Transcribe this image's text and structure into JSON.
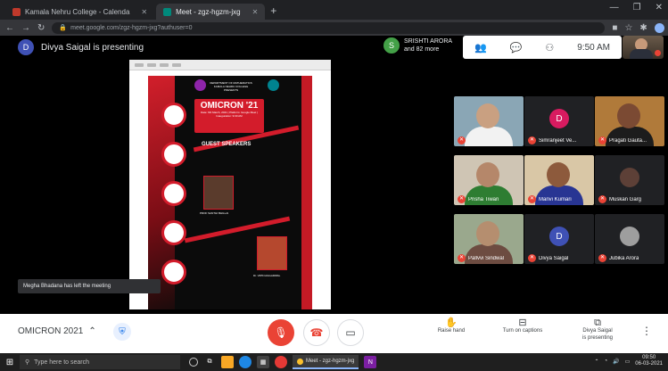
{
  "browser": {
    "tabs": [
      {
        "label": "Kamala Nehru College - Calenda",
        "favicon_color": "#c0392b",
        "active": false
      },
      {
        "label": "Meet - zgz-hgzm-jxg",
        "favicon_color": "#00897b",
        "active": true
      }
    ],
    "url": "meet.google.com/zgz-hgzm-jxg?authuser=0"
  },
  "meet": {
    "presenter_initial": "D",
    "presenter_text": "Divya Saigal is presenting",
    "pinned_initial": "S",
    "pinned_name": "SRISHTI ARORA",
    "pinned_more": "and 82 more",
    "clock": "9:50 AM",
    "toast": "Megha Bhadana has left the meeting",
    "meeting_title": "OMICRON 2021"
  },
  "poster": {
    "dept_line1": "DEPARTMENT OF MATHEMATICS",
    "dept_line2": "KAMALA NEHRU COLLEGE",
    "dept_line3": "PRESENTS",
    "event": "OMICRON '21",
    "event_details": "Date: 6th March, 2021 | Platform: Google Meet | Inauguration: 9:30 AM",
    "guest_heading": "GUEST SPEAKERS",
    "guest1": "PROF SANTHI BHILLAI",
    "guest2": "Dr. VIPIN AGGARWAL"
  },
  "participants": [
    {
      "name": "",
      "initial": "",
      "video": true,
      "skin": "#c9a081",
      "cloth": "#f2f2f2",
      "bg": "#8aa6b5"
    },
    {
      "name": "Simranjeet Ve...",
      "initial": "D",
      "video": false,
      "avatar_color": "#d81b60"
    },
    {
      "name": "Pragati Gauta...",
      "initial": "",
      "video": true,
      "skin": "#7b4a33",
      "cloth": "#1c1c1c",
      "bg": "#b07a3a"
    },
    {
      "name": "Prisha Tiwari",
      "initial": "",
      "video": true,
      "skin": "#b5876a",
      "cloth": "#2e7d32",
      "bg": "#cfc5b4"
    },
    {
      "name": "Manvi Kumari",
      "initial": "",
      "video": true,
      "skin": "#8d5a3c",
      "cloth": "#283593",
      "bg": "#d9c7a6"
    },
    {
      "name": "Muskan Garg",
      "initial": "",
      "video": false,
      "avatar_color": "#5d4037"
    },
    {
      "name": "Pallvvi Sindwal",
      "initial": "",
      "video": true,
      "skin": "#b58e6f",
      "cloth": "#6d4c41",
      "bg": "#9aa88d"
    },
    {
      "name": "Divya Saigal",
      "initial": "D",
      "video": false,
      "avatar_color": "#3f51b5"
    },
    {
      "name": "Jubika Arora",
      "initial": "",
      "video": false,
      "avatar_color": "#9e9e9e"
    }
  ],
  "controls": {
    "raise_hand": "Raise hand",
    "captions": "Turn on captions",
    "presenting_line1": "Divya Saigal",
    "presenting_line2": "is presenting"
  },
  "taskbar": {
    "search_placeholder": "Type here to search",
    "active_app": "Meet - zgz-hgzm-jxg",
    "time": "09:50",
    "date": "06-03-2021"
  },
  "colors": {
    "accent_red": "#ea4335",
    "meet_blue": "#1a73e8"
  }
}
